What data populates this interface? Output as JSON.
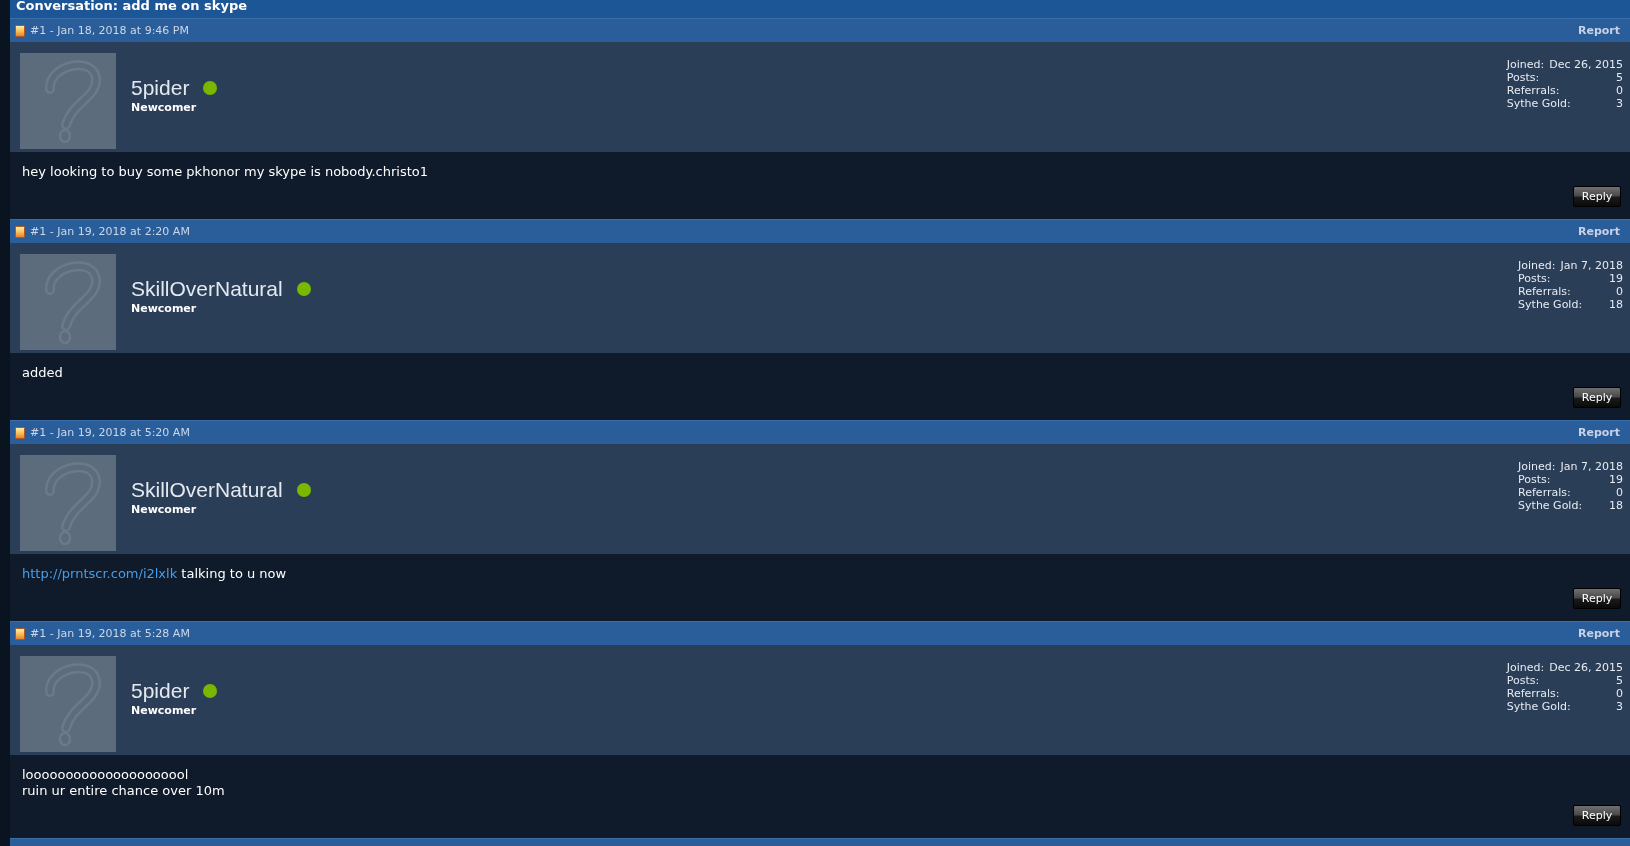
{
  "conversation": {
    "title": "Conversation: add me on skype"
  },
  "posts": [
    {
      "header": "#1 - Jan 18, 2018 at 9:46 PM",
      "report": "Report",
      "user": {
        "name": "5pider",
        "online": true,
        "rank": "Newcomer"
      },
      "stats": [
        {
          "label": "Joined:",
          "value": "Dec 26, 2015"
        },
        {
          "label": "Posts:",
          "value": "5"
        },
        {
          "label": "Referrals:",
          "value": "0"
        },
        {
          "label": "Sythe Gold:",
          "value": "3"
        }
      ],
      "message": [
        [
          {
            "kind": "text",
            "text": "hey looking to buy some pkhonor my skype is nobody.christo1"
          }
        ]
      ],
      "reply": "Reply"
    },
    {
      "header": "#1 - Jan 19, 2018 at 2:20 AM",
      "report": "Report",
      "user": {
        "name": "SkillOverNatural",
        "online": true,
        "rank": "Newcomer"
      },
      "stats": [
        {
          "label": "Joined:",
          "value": "Jan 7, 2018"
        },
        {
          "label": "Posts:",
          "value": "19"
        },
        {
          "label": "Referrals:",
          "value": "0"
        },
        {
          "label": "Sythe Gold:",
          "value": "18"
        }
      ],
      "message": [
        [
          {
            "kind": "text",
            "text": "added"
          }
        ]
      ],
      "reply": "Reply"
    },
    {
      "header": "#1 - Jan 19, 2018 at 5:20 AM",
      "report": "Report",
      "user": {
        "name": "SkillOverNatural",
        "online": true,
        "rank": "Newcomer"
      },
      "stats": [
        {
          "label": "Joined:",
          "value": "Jan 7, 2018"
        },
        {
          "label": "Posts:",
          "value": "19"
        },
        {
          "label": "Referrals:",
          "value": "0"
        },
        {
          "label": "Sythe Gold:",
          "value": "18"
        }
      ],
      "message": [
        [
          {
            "kind": "link",
            "text": "http://prntscr.com/i2lxlk"
          },
          {
            "kind": "text",
            "text": " talking to u now"
          }
        ]
      ],
      "reply": "Reply"
    },
    {
      "header": "#1 - Jan 19, 2018 at 5:28 AM",
      "report": "Report",
      "user": {
        "name": "5pider",
        "online": true,
        "rank": "Newcomer"
      },
      "stats": [
        {
          "label": "Joined:",
          "value": "Dec 26, 2015"
        },
        {
          "label": "Posts:",
          "value": "5"
        },
        {
          "label": "Referrals:",
          "value": "0"
        },
        {
          "label": "Sythe Gold:",
          "value": "3"
        }
      ],
      "message": [
        [
          {
            "kind": "text",
            "text": "looooooooooooooooooool"
          }
        ],
        [
          {
            "kind": "text",
            "text": "ruin ur entire chance over 10m"
          }
        ]
      ],
      "reply": "Reply"
    }
  ]
}
